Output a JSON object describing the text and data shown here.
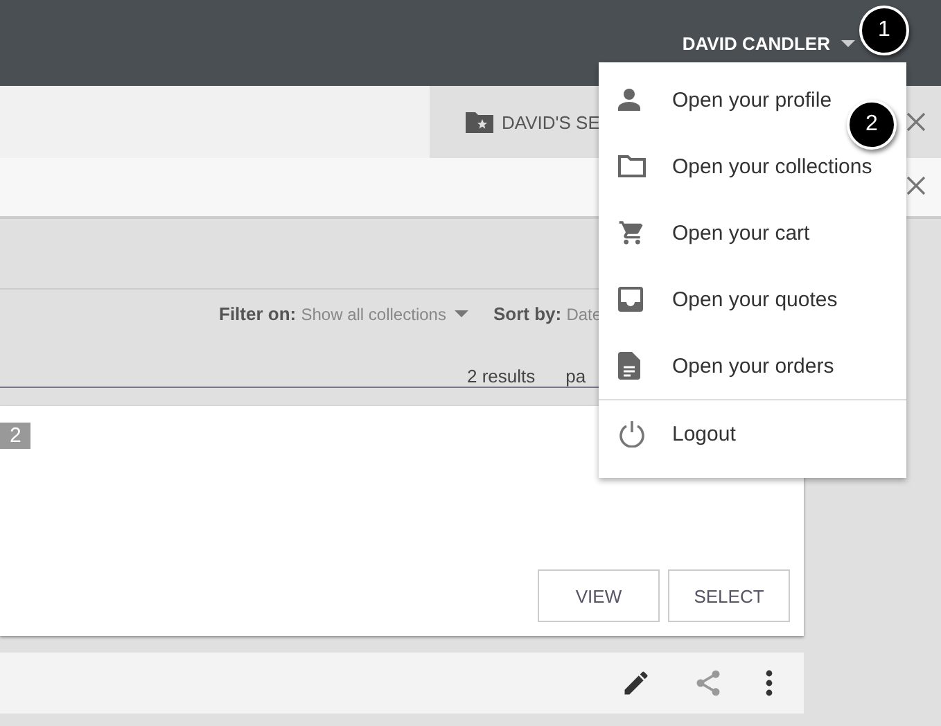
{
  "user_menu": {
    "name": "DAVID CANDLER",
    "items": [
      {
        "kind": "profile",
        "label": "Open your profile"
      },
      {
        "kind": "collections",
        "label": "Open your collections"
      },
      {
        "kind": "cart",
        "label": "Open your cart"
      },
      {
        "kind": "quotes",
        "label": "Open your quotes"
      },
      {
        "kind": "orders",
        "label": "Open your orders"
      },
      {
        "kind": "logout",
        "label": "Logout"
      }
    ]
  },
  "callouts": [
    "1",
    "2"
  ],
  "tab": {
    "label": "DAVID'S SE"
  },
  "filter": {
    "label": "Filter on:",
    "value": "Show all collections"
  },
  "sort": {
    "label": "Sort by:",
    "value": "Date"
  },
  "results": "2 results",
  "pagination": "pa",
  "card": {
    "badge": "2",
    "buttons": [
      "VIEW",
      "SELECT"
    ]
  }
}
